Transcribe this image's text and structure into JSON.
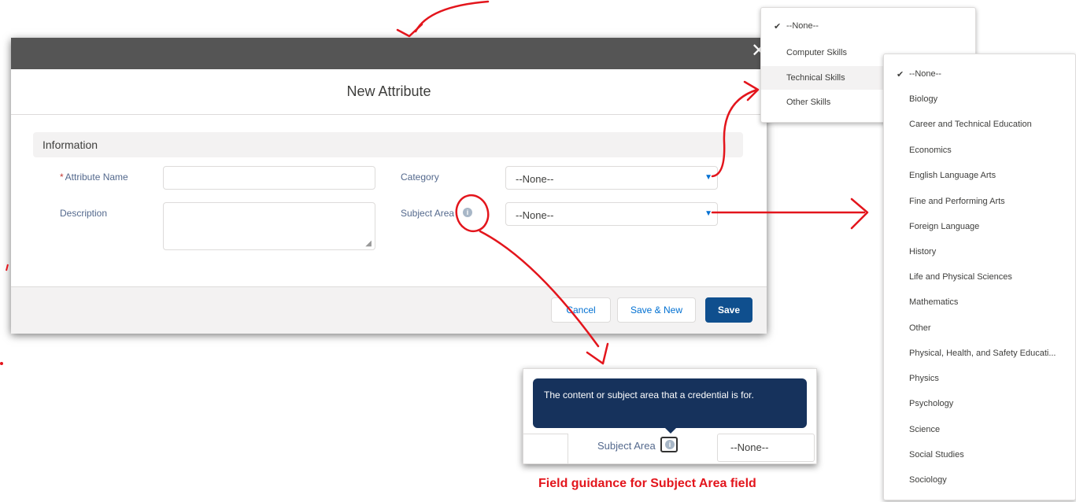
{
  "modal": {
    "close_glyph": "✕",
    "title": "New Attribute",
    "section": "Information",
    "fields": {
      "attribute_name_required": "*",
      "attribute_name_label": "Attribute Name",
      "attribute_name_value": "",
      "description_label": "Description",
      "description_value": "",
      "category_label": "Category",
      "category_value": "--None--",
      "subject_area_label": "Subject Area",
      "subject_area_value": "--None--"
    },
    "buttons": {
      "cancel": "Cancel",
      "save_and_new": "Save & New",
      "save": "Save"
    }
  },
  "category_dropdown": {
    "items": [
      "--None--",
      "Computer Skills",
      "Technical Skills",
      "Other Skills"
    ],
    "selected": "--None--",
    "hovered": "Technical Skills"
  },
  "subject_area_dropdown": {
    "items": [
      "--None--",
      "Biology",
      "Career and Technical Education",
      "Economics",
      "English Language Arts",
      "Fine and Performing Arts",
      "Foreign Language",
      "History",
      "Life and Physical Sciences",
      "Mathematics",
      "Other",
      "Physical, Health, and Safety Educati...",
      "Physics",
      "Psychology",
      "Science",
      "Social Studies",
      "Sociology"
    ],
    "selected": "--None--"
  },
  "tooltip_inset": {
    "tooltip_text": "The content or subject area that a credential is for.",
    "field_label": "Subject Area",
    "field_value": "--None--"
  },
  "annotation": {
    "caption": "Field guidance for Subject Area field",
    "color": "#e3151c"
  },
  "icons": {
    "checkmark": "✔",
    "caret": "▼",
    "info": "i"
  }
}
